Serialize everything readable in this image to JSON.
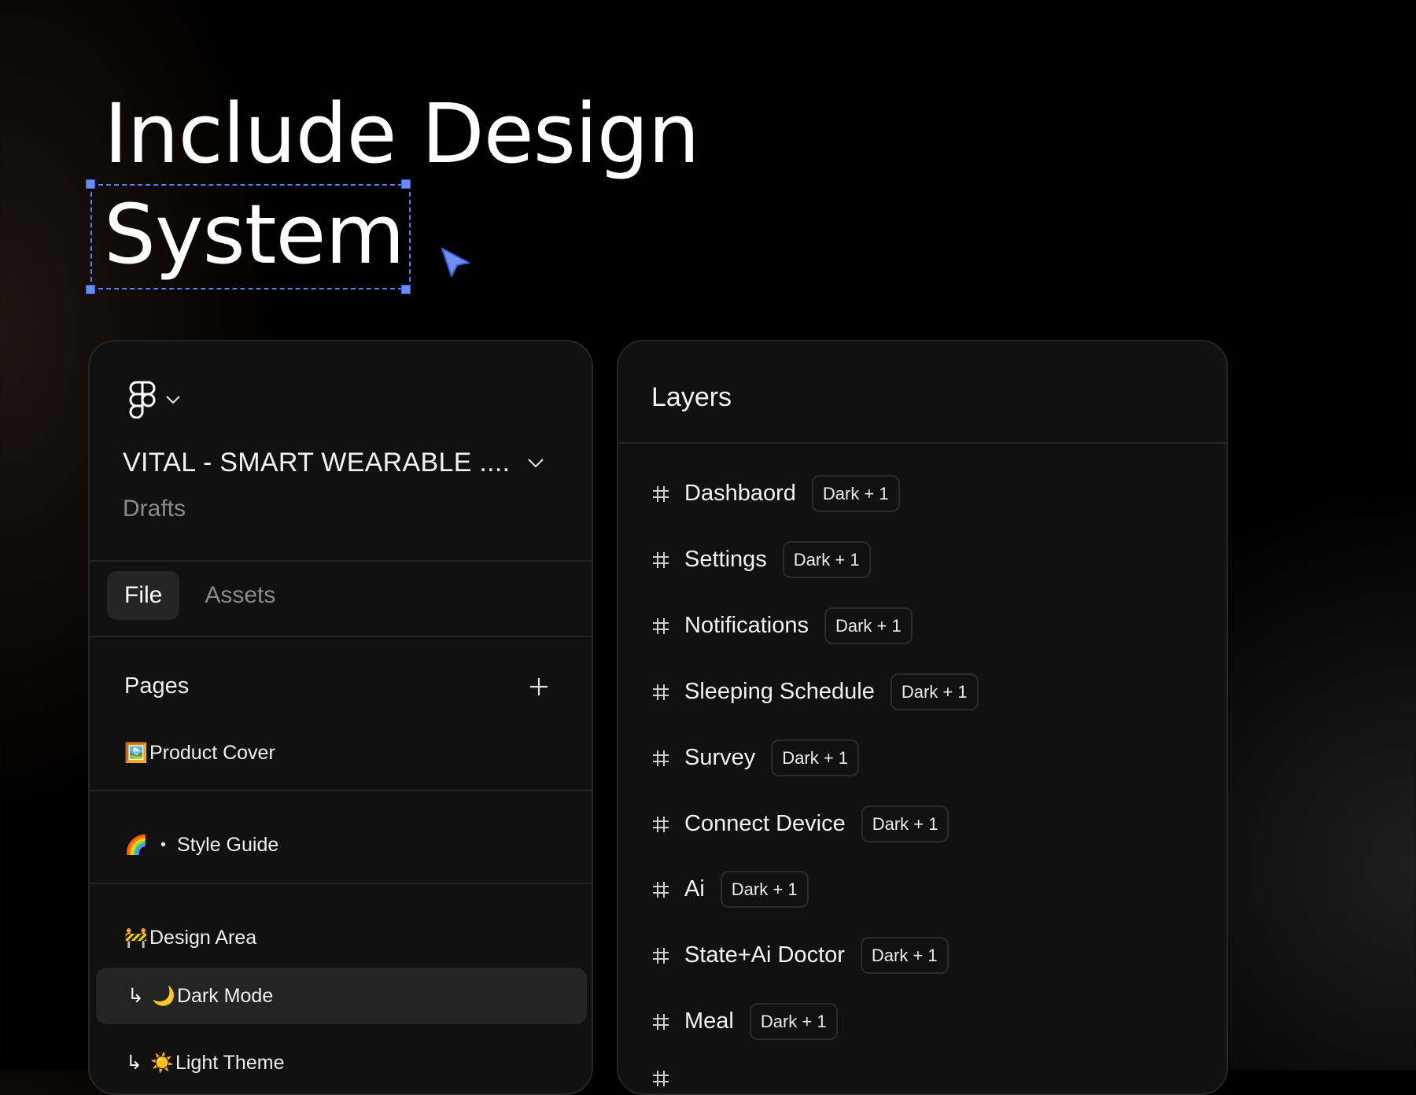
{
  "headline": {
    "line1": "Include Design",
    "line2": "System"
  },
  "left_panel": {
    "project_title": "VITAL - SMART WEARABLE ....",
    "project_location": "Drafts",
    "tabs": [
      {
        "label": "File",
        "active": true
      },
      {
        "label": "Assets",
        "active": false
      }
    ],
    "pages_title": "Pages",
    "pages": [
      {
        "emoji": "🖼️",
        "label": "Product Cover"
      },
      {
        "emoji": "🌈",
        "bullet": "•",
        "label": "Style Guide"
      },
      {
        "emoji": "🚧",
        "label": "Design Area"
      },
      {
        "prefix": "↳",
        "emoji": "🌙",
        "label": "Dark Mode",
        "selected": true
      },
      {
        "prefix": "↳",
        "emoji": "☀️",
        "label": "Light Theme"
      }
    ]
  },
  "right_panel": {
    "title": "Layers",
    "layers": [
      {
        "name": "Dashbaord",
        "badge": "Dark + 1"
      },
      {
        "name": "Settings",
        "badge": "Dark + 1"
      },
      {
        "name": "Notifications",
        "badge": "Dark + 1"
      },
      {
        "name": "Sleeping Schedule",
        "badge": "Dark + 1"
      },
      {
        "name": "Survey",
        "badge": "Dark + 1"
      },
      {
        "name": "Connect Device",
        "badge": "Dark + 1"
      },
      {
        "name": "Ai",
        "badge": "Dark + 1"
      },
      {
        "name": "State+Ai Doctor",
        "badge": "Dark + 1"
      },
      {
        "name": "Meal",
        "badge": "Dark + 1"
      },
      {
        "name": "",
        "badge": ""
      }
    ]
  },
  "colors": {
    "selection": "#5b7de8",
    "panel_bg": "#111111",
    "background": "#000000"
  },
  "icons": [
    "figma-logo-icon",
    "chevron-down-icon",
    "plus-icon",
    "frame-hash-icon",
    "pointer-cursor-icon"
  ]
}
